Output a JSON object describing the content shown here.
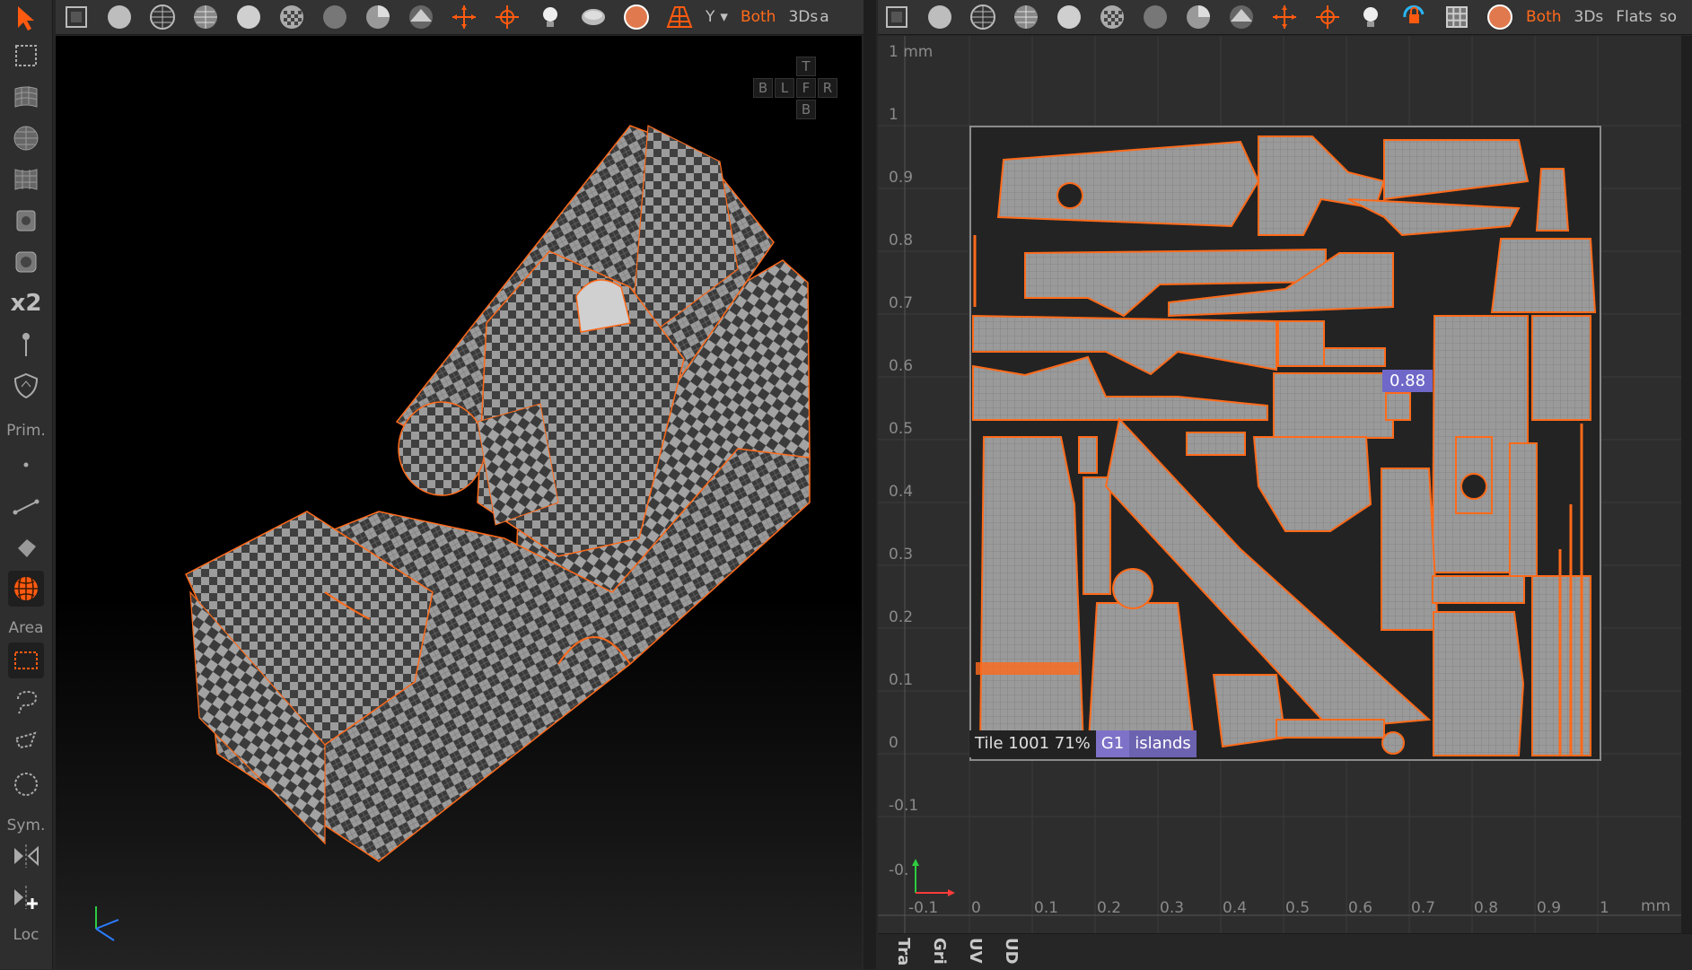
{
  "left_toolbar": {
    "x2_label": "x2",
    "prim_label": "Prim.",
    "area_label": "Area",
    "sym_label": "Sym.",
    "loc_label": "Loc"
  },
  "toolbar3d": {
    "axis_label": "Y",
    "both_label": "Both",
    "mode_label": "3Ds",
    "cut_label": "a"
  },
  "toolbar_uv": {
    "both_label": "Both",
    "mode_label": "3Ds",
    "flats_label": "Flats",
    "cut_label": "so"
  },
  "navcube": {
    "top": "T",
    "back": "B",
    "left": "L",
    "front": "F",
    "right": "R",
    "bottom": "B"
  },
  "uv_view": {
    "unit_top": "1 mm",
    "unit_bottom": "mm",
    "y_ticks": [
      "1",
      "0.9",
      "0.8",
      "0.7",
      "0.6",
      "0.5",
      "0.4",
      "0.3",
      "0.2",
      "0.1",
      "0",
      "-0.1",
      "-0."
    ],
    "x_ticks": [
      "-0.1",
      "0",
      "0.1",
      "0.2",
      "0.3",
      "0.4",
      "0.5",
      "0.6",
      "0.7",
      "0.8",
      "0.9",
      "1"
    ],
    "tile_label": "Tile 1001 71%",
    "group_label": "G1",
    "islands_label": "islands",
    "badge_value": "0.88"
  },
  "bottom_tabs": [
    "Tra",
    "Gri",
    "UV",
    "UD"
  ],
  "colors": {
    "accent": "#ff6a1a",
    "selection_purple": "#7d72c8",
    "panel": "#2d2d2d",
    "viewport": "#000000"
  }
}
